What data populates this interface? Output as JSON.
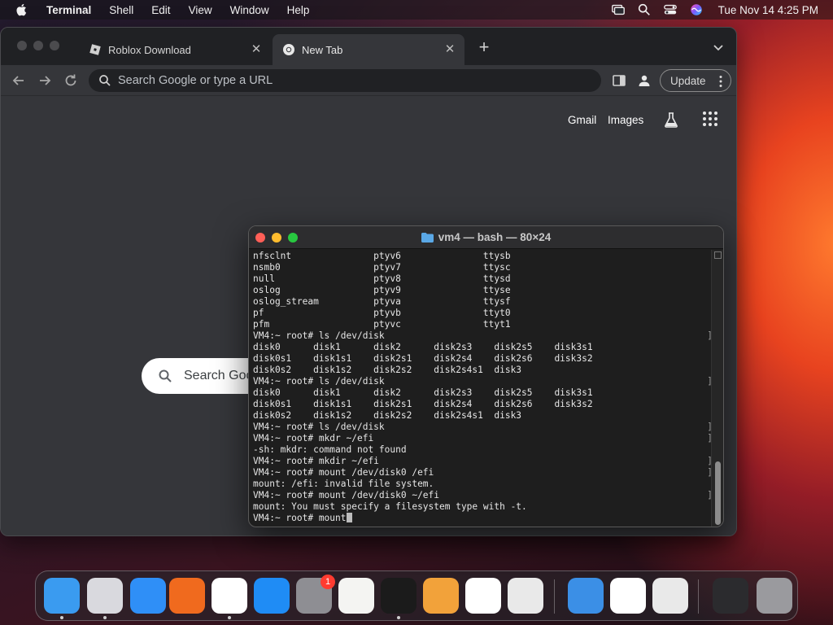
{
  "menubar": {
    "app_name": "Terminal",
    "items": [
      "Shell",
      "Edit",
      "View",
      "Window",
      "Help"
    ],
    "clock": "Tue Nov 14  4:25 PM"
  },
  "chrome": {
    "tabs": [
      {
        "title": "Roblox Download",
        "favicon": "roblox-icon"
      },
      {
        "title": "New Tab",
        "favicon": "chrome-icon",
        "active": true
      }
    ],
    "omnibox_placeholder": "Search Google or type a URL",
    "update_label": "Update",
    "ntp": {
      "links": [
        "Gmail",
        "Images"
      ],
      "search_placeholder": "Search Goo"
    }
  },
  "terminal": {
    "title": "vm4 — bash — 80×24",
    "lines": [
      {
        "text": "nfsclnt               ptyv6               ttysb",
        "bracket": false
      },
      {
        "text": "nsmb0                 ptyv7               ttysc",
        "bracket": false
      },
      {
        "text": "null                  ptyv8               ttysd",
        "bracket": false
      },
      {
        "text": "oslog                 ptyv9               ttyse",
        "bracket": false
      },
      {
        "text": "oslog_stream          ptyva               ttysf",
        "bracket": false
      },
      {
        "text": "pf                    ptyvb               ttyt0",
        "bracket": false
      },
      {
        "text": "pfm                   ptyvc               ttyt1",
        "bracket": false
      },
      {
        "text": "VM4:~ root# ls /dev/disk",
        "bracket": true
      },
      {
        "text": "disk0      disk1      disk2      disk2s3    disk2s5    disk3s1",
        "bracket": false
      },
      {
        "text": "disk0s1    disk1s1    disk2s1    disk2s4    disk2s6    disk3s2",
        "bracket": false
      },
      {
        "text": "disk0s2    disk1s2    disk2s2    disk2s4s1  disk3",
        "bracket": false
      },
      {
        "text": "VM4:~ root# ls /dev/disk",
        "bracket": true
      },
      {
        "text": "disk0      disk1      disk2      disk2s3    disk2s5    disk3s1",
        "bracket": false
      },
      {
        "text": "disk0s1    disk1s1    disk2s1    disk2s4    disk2s6    disk3s2",
        "bracket": false
      },
      {
        "text": "disk0s2    disk1s2    disk2s2    disk2s4s1  disk3",
        "bracket": false
      },
      {
        "text": "VM4:~ root# ls /dev/disk",
        "bracket": true
      },
      {
        "text": "VM4:~ root# mkdr ~/efi",
        "bracket": true
      },
      {
        "text": "-sh: mkdr: command not found",
        "bracket": false
      },
      {
        "text": "VM4:~ root# mkdir ~/efi",
        "bracket": true
      },
      {
        "text": "VM4:~ root# mount /dev/disk0 /efi",
        "bracket": true
      },
      {
        "text": "mount: /efi: invalid file system.",
        "bracket": false
      },
      {
        "text": "VM4:~ root# mount /dev/disk0 ~/efi",
        "bracket": true
      },
      {
        "text": "mount: You must specify a filesystem type with -t.",
        "bracket": false
      },
      {
        "text": "VM4:~ root# mount",
        "bracket": false,
        "cursor": true
      }
    ]
  },
  "dock": {
    "apps": [
      {
        "name": "finder",
        "color": "#3a9bf0"
      },
      {
        "name": "launchpad",
        "color": "#d9d9de"
      },
      {
        "name": "safari",
        "color": "#2f8ff7"
      },
      {
        "name": "firefox",
        "color": "#f06a1e"
      },
      {
        "name": "chrome",
        "color": "#ffffff"
      },
      {
        "name": "app-store",
        "color": "#1f8cf5"
      },
      {
        "name": "system-settings",
        "color": "#8e8e93",
        "badge": "1"
      },
      {
        "name": "textedit",
        "color": "#f4f4f2"
      },
      {
        "name": "terminal",
        "color": "#1b1b1b"
      },
      {
        "name": "garageband",
        "color": "#f2a23a"
      },
      {
        "name": "vscode",
        "color": "#ffffff"
      },
      {
        "name": "roblox",
        "color": "#e9e9e9"
      },
      {
        "name": "weather",
        "color": "#3b8fe6"
      },
      {
        "name": "photos",
        "color": "#ffffff"
      },
      {
        "name": "roblox-studio",
        "color": "#e9e9e9"
      },
      {
        "name": "window-thumbnail",
        "color": "#2b2b2e"
      },
      {
        "name": "trash",
        "color": "#9a9a9e"
      }
    ]
  }
}
